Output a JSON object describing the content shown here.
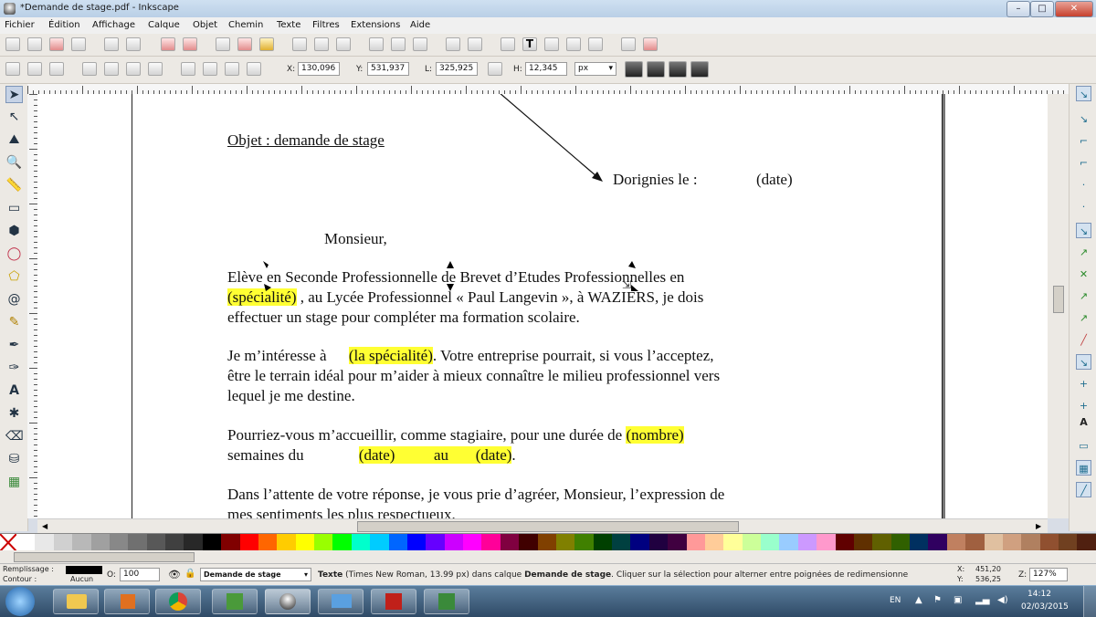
{
  "window": {
    "title": "*Demande de stage.pdf - Inkscape"
  },
  "menu": [
    "Fichier",
    "Édition",
    "Affichage",
    "Calque",
    "Objet",
    "Chemin",
    "Texte",
    "Filtres",
    "Extensions",
    "Aide"
  ],
  "coords": {
    "x_label": "X:",
    "x_value": "130,096",
    "y_label": "Y:",
    "y_value": "531,937",
    "w_label": "L:",
    "w_value": "325,925",
    "h_label": "H:",
    "h_value": "12,345",
    "unit": "px"
  },
  "document": {
    "subject": "Objet : demande de stage",
    "place_date": "Dorignies le :",
    "date_placeholder": "(date)",
    "salutation": "Monsieur,",
    "p1_l1": "Elève en Seconde Professionnelle de Brevet d’Etudes Professionnelles en",
    "p1_l2_hl": "(spécialité)",
    "p1_l2_rest": " , au Lycée Professionnel « Paul Langevin », à WAZIERS, je dois",
    "p1_l3": "effectuer un stage pour compléter ma formation scolaire.",
    "p2_l1_a": "Je m’intéresse à ",
    "p2_l1_hl": "(la spécialité)",
    "p2_l1_b": ". Votre entreprise pourrait, si vous l’acceptez,",
    "p2_l2": "être le terrain idéal pour m’aider à mieux connaître le milieu professionnel vers",
    "p2_l3": "lequel je me destine.",
    "p3_l1_a": "Pourriez-vous m’accueillir, comme stagiaire, pour une durée de ",
    "p3_l1_hl": "(nombre)",
    "p3_l2_a": "semaines du ",
    "p3_l2_hl": "(date)          au       (date)",
    "p3_l2_b": ".",
    "p4_l1": "Dans l’attente de votre réponse, je vous prie d’agréer, Monsieur, l’expression de",
    "p4_l2": "mes sentiments les plus respectueux."
  },
  "status": {
    "fill_label": "Remplissage :",
    "stroke_label": "Contour :",
    "stroke_value": "Aucun",
    "opacity_label": "O:",
    "opacity_value": "100",
    "layer": "Demande de stage",
    "message_prefix": "Texte",
    "message_middle": " (Times New Roman, 13.99 px) dans calque ",
    "message_layer": "Demande de stage",
    "message_suffix": ". Cliquer sur la sélection pour alterner entre poignées de redimensionne",
    "cursor_x_label": "X:",
    "cursor_x": "451,20",
    "cursor_y_label": "Y:",
    "cursor_y": "536,25",
    "zoom_label": "Z:",
    "zoom": "127%"
  },
  "taskbar": {
    "lang": "EN",
    "time": "14:12",
    "date": "02/03/2015"
  },
  "palette_colors": [
    "#ffffff",
    "#e8e8e8",
    "#d0d0d0",
    "#b8b8b8",
    "#a0a0a0",
    "#888888",
    "#707070",
    "#585858",
    "#404040",
    "#282828",
    "#000000",
    "#800000",
    "#ff0000",
    "#ff6600",
    "#ffcc00",
    "#ffff00",
    "#99ff00",
    "#00ff00",
    "#00ffcc",
    "#00ccff",
    "#0066ff",
    "#0000ff",
    "#6600ff",
    "#cc00ff",
    "#ff00ff",
    "#ff0099",
    "#800040",
    "#400000",
    "#804000",
    "#808000",
    "#408000",
    "#004000",
    "#004040",
    "#000080",
    "#200040",
    "#400040",
    "#ff9999",
    "#ffcc99",
    "#ffff99",
    "#ccff99",
    "#99ffcc",
    "#99ccff",
    "#cc99ff",
    "#ff99cc",
    "#600000",
    "#603000",
    "#606000",
    "#306000",
    "#003060",
    "#300060",
    "#c08060",
    "#a06040",
    "#e0c0a0",
    "#d0a080",
    "#b08060",
    "#905030",
    "#704020",
    "#502010"
  ]
}
